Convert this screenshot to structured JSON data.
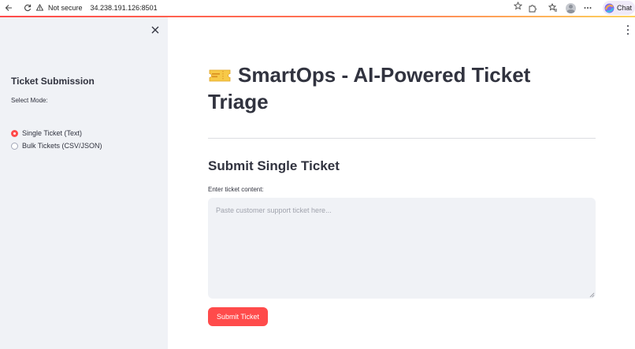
{
  "browser": {
    "security_label": "Not secure",
    "url": "34.238.191.126:8501",
    "chat_label": "Chat"
  },
  "sidebar": {
    "title": "Ticket Submission",
    "mode_label": "Select Mode:",
    "modes": [
      {
        "label": "Single Ticket (Text)",
        "selected": true
      },
      {
        "label": "Bulk Tickets (CSV/JSON)",
        "selected": false
      }
    ]
  },
  "main": {
    "title": "SmartOps - AI-Powered Ticket Triage",
    "section_title": "Submit Single Ticket",
    "field_label": "Enter ticket content:",
    "textarea_value": "",
    "textarea_placeholder": "Paste customer support ticket here...",
    "submit_label": "Submit Ticket"
  },
  "colors": {
    "accent": "#ff4b4b",
    "sidebar_bg": "#f0f2f6",
    "text": "#31333f"
  }
}
